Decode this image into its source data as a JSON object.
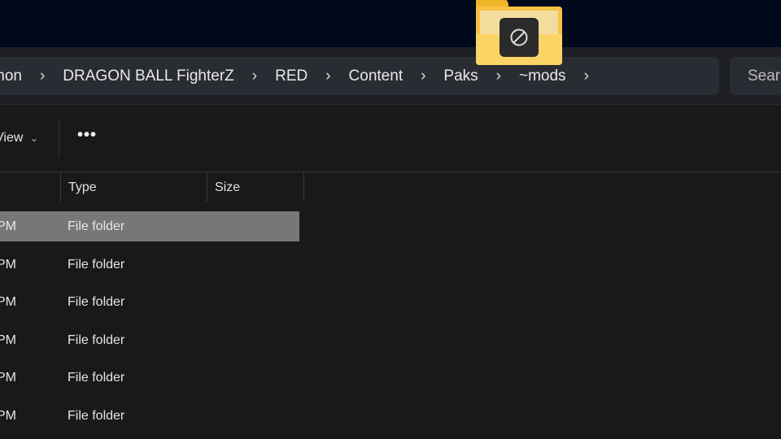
{
  "breadcrumb": {
    "items": [
      "mon",
      "DRAGON BALL FighterZ",
      "RED",
      "Content",
      "Paks",
      "~mods"
    ]
  },
  "search": {
    "placeholder": "Search"
  },
  "toolbar": {
    "view_label": "View",
    "view_chevron": "⌄",
    "more_label": "•••"
  },
  "columns": {
    "type": "Type",
    "size": "Size"
  },
  "rows": [
    {
      "date": "PM",
      "type": "File folder",
      "selected": true
    },
    {
      "date": "PM",
      "type": "File folder"
    },
    {
      "date": "PM",
      "type": "File folder"
    },
    {
      "date": "PM",
      "type": "File folder"
    },
    {
      "date": "PM",
      "type": "File folder"
    },
    {
      "date": "PM",
      "type": "File folder"
    }
  ],
  "drag_overlay": {
    "icon": "folder-icon",
    "badge": "no-entry-icon"
  },
  "colors": {
    "folder": "#f5c242",
    "selection": "#777777",
    "top": "#000a1c"
  }
}
